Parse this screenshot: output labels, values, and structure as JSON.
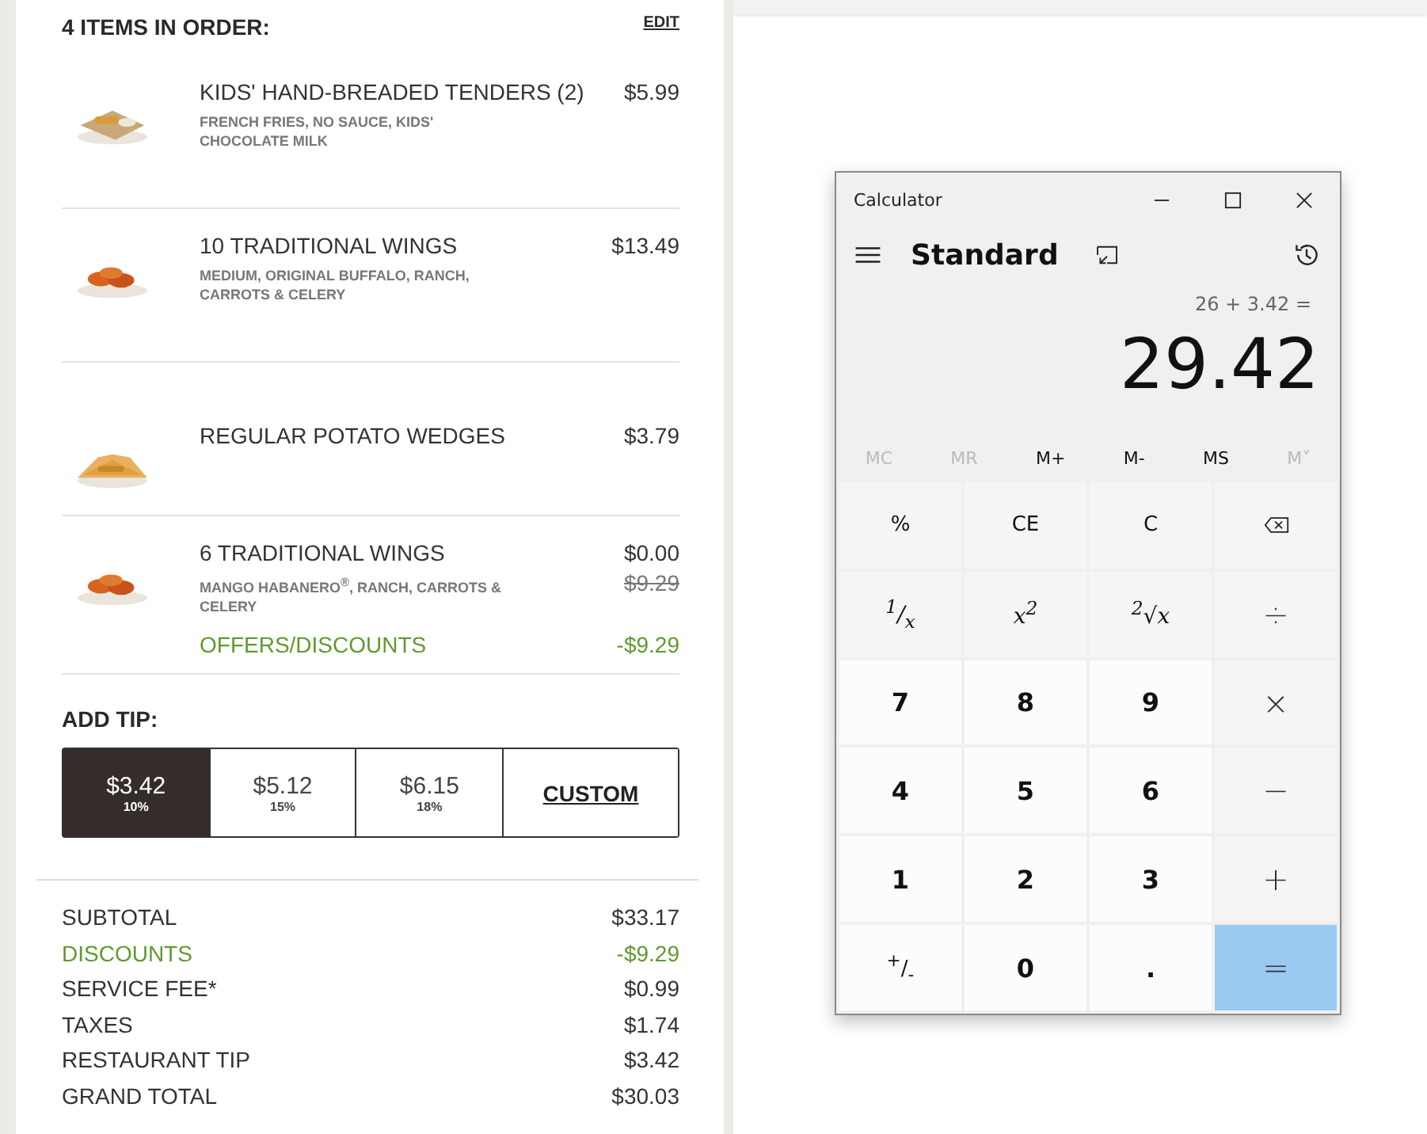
{
  "order": {
    "heading": "4 ITEMS IN ORDER:",
    "edit_link": "EDIT",
    "items": [
      {
        "name": "KIDS' HAND-BREADED TENDERS (2)",
        "options": "FRENCH FRIES, NO SAUCE, KIDS' CHOCOLATE MILK",
        "price": "$5.99"
      },
      {
        "name": "10 TRADITIONAL WINGS",
        "options": "MEDIUM, ORIGINAL BUFFALO, RANCH, CARROTS & CELERY",
        "price": "$13.49"
      },
      {
        "name": "REGULAR POTATO WEDGES",
        "price": "$3.79"
      },
      {
        "name": "6 TRADITIONAL WINGS",
        "options": "MANGO HABANERO$^{®}$, RANCH, CARROTS & CELERY",
        "price": "$0.00",
        "original_price": "$9.29",
        "offer": {
          "label": "OFFERS/DISCOUNTS",
          "amount": "-$9.29"
        }
      }
    ]
  },
  "tip": {
    "label": "ADD TIP:",
    "options": [
      {
        "kind": "amount",
        "amount": "$3.42",
        "percent": "10%",
        "selected": true
      },
      {
        "kind": "amount",
        "amount": "$5.12",
        "percent": "15%",
        "selected": false
      },
      {
        "kind": "amount",
        "amount": "$6.15",
        "percent": "18%",
        "selected": false
      },
      {
        "kind": "custom",
        "label": "CUSTOM",
        "selected": false
      }
    ]
  },
  "summary": [
    {
      "kind": "normal",
      "label": "SUBTOTAL",
      "value": "$33.17"
    },
    {
      "kind": "discount",
      "label": "DISCOUNTS",
      "value": "-$9.29"
    },
    {
      "kind": "normal",
      "label": "SERVICE FEE*",
      "value": "$0.99"
    },
    {
      "kind": "normal",
      "label": "TAXES",
      "value": "$1.74"
    },
    {
      "kind": "normal",
      "label": "RESTAURANT TIP",
      "value": "$3.42"
    },
    {
      "kind": "normal",
      "label": "GRAND TOTAL",
      "value": "$30.03"
    }
  ],
  "calculator": {
    "title": "Calculator",
    "mode": "Standard",
    "expression": "26 + 3.42 =",
    "result": "29.42",
    "memory": [
      {
        "label": "MC",
        "disabled": true
      },
      {
        "label": "MR",
        "disabled": true
      },
      {
        "label": "M+",
        "disabled": false
      },
      {
        "label": "M-",
        "disabled": false
      },
      {
        "label": "MS",
        "disabled": false
      },
      {
        "label": "M˅",
        "disabled": true
      }
    ],
    "keys": [
      {
        "kind": "op",
        "label": "%"
      },
      {
        "kind": "op",
        "label": "CE"
      },
      {
        "kind": "op",
        "label": "C"
      },
      {
        "kind": "backspace"
      },
      {
        "kind": "fn",
        "label": "$^{1}$/$_{x}$"
      },
      {
        "kind": "fn",
        "label": "x$^{2}$"
      },
      {
        "kind": "fn",
        "label": "$^{2}$√x"
      },
      {
        "kind": "sym",
        "label": "÷"
      },
      {
        "kind": "num",
        "label": "7"
      },
      {
        "kind": "num",
        "label": "8"
      },
      {
        "kind": "num",
        "label": "9"
      },
      {
        "kind": "sym",
        "label": "×"
      },
      {
        "kind": "num",
        "label": "4"
      },
      {
        "kind": "num",
        "label": "5"
      },
      {
        "kind": "num",
        "label": "6"
      },
      {
        "kind": "sym",
        "label": "−"
      },
      {
        "kind": "num",
        "label": "1"
      },
      {
        "kind": "num",
        "label": "2"
      },
      {
        "kind": "num",
        "label": "3"
      },
      {
        "kind": "sym",
        "label": "+"
      },
      {
        "kind": "numfn",
        "label": "$^{+}$/$_{-}$"
      },
      {
        "kind": "num",
        "label": "0"
      },
      {
        "kind": "num",
        "label": "."
      },
      {
        "kind": "equals",
        "label": "="
      }
    ]
  }
}
